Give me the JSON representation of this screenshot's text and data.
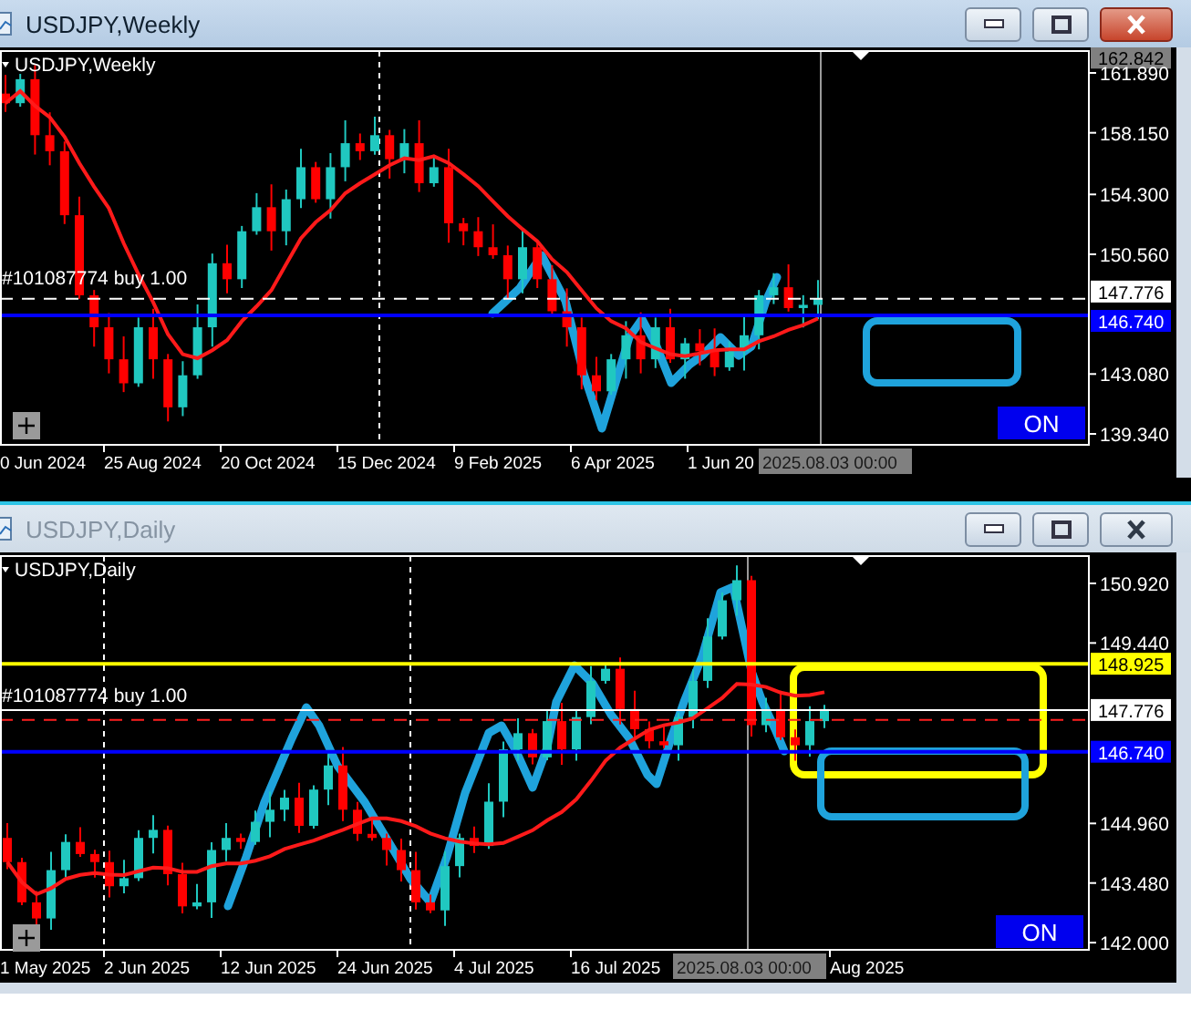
{
  "windows": [
    {
      "title": "USDJPY,Weekly",
      "active": true,
      "chart_label": "USDJPY,Weekly",
      "order_label": "#101087774 buy 1.00",
      "price_labels": [
        {
          "text": "162.842",
          "kind": "high"
        },
        {
          "text": "161.890",
          "kind": "tick"
        },
        {
          "text": "158.150",
          "kind": "tick"
        },
        {
          "text": "154.300",
          "kind": "tick"
        },
        {
          "text": "150.560",
          "kind": "tick"
        },
        {
          "text": "147.776",
          "kind": "last"
        },
        {
          "text": "146.740",
          "kind": "line"
        },
        {
          "text": "143.080",
          "kind": "tick"
        },
        {
          "text": "139.340",
          "kind": "tick"
        }
      ],
      "time_labels": [
        {
          "text": "0 Jun 2024",
          "kind": "date"
        },
        {
          "text": "25 Aug 2024",
          "kind": "date"
        },
        {
          "text": "20 Oct 2024",
          "kind": "date"
        },
        {
          "text": "15 Dec 2024",
          "kind": "date"
        },
        {
          "text": "9 Feb 2025",
          "kind": "date"
        },
        {
          "text": "6 Apr 2025",
          "kind": "date"
        },
        {
          "text": "1 Jun 20",
          "kind": "date"
        },
        {
          "text": "2025.08.03 00:00",
          "kind": "crosshair"
        }
      ],
      "toggle": {
        "label": "ON"
      }
    },
    {
      "title": "USDJPY,Daily",
      "active": false,
      "chart_label": "USDJPY,Daily",
      "order_label": "#101087774 buy 1.00",
      "price_labels": [
        {
          "text": "150.920",
          "kind": "tick"
        },
        {
          "text": "149.440",
          "kind": "tick"
        },
        {
          "text": "148.925",
          "kind": "level"
        },
        {
          "text": "147.776",
          "kind": "last"
        },
        {
          "text": "146.740",
          "kind": "line"
        },
        {
          "text": "144.960",
          "kind": "tick"
        },
        {
          "text": "143.480",
          "kind": "tick"
        },
        {
          "text": "142.000",
          "kind": "tick"
        }
      ],
      "time_labels": [
        {
          "text": "1 May 2025",
          "kind": "date"
        },
        {
          "text": "2 Jun 2025",
          "kind": "date"
        },
        {
          "text": "12 Jun 2025",
          "kind": "date"
        },
        {
          "text": "24 Jun 2025",
          "kind": "date"
        },
        {
          "text": "4 Jul 2025",
          "kind": "date"
        },
        {
          "text": "16 Jul 2025",
          "kind": "date"
        },
        {
          "text": "2025.08.03 00:00",
          "kind": "crosshair"
        },
        {
          "text": "Aug 2025",
          "kind": "date"
        }
      ],
      "toggle": {
        "label": "ON"
      }
    }
  ]
}
